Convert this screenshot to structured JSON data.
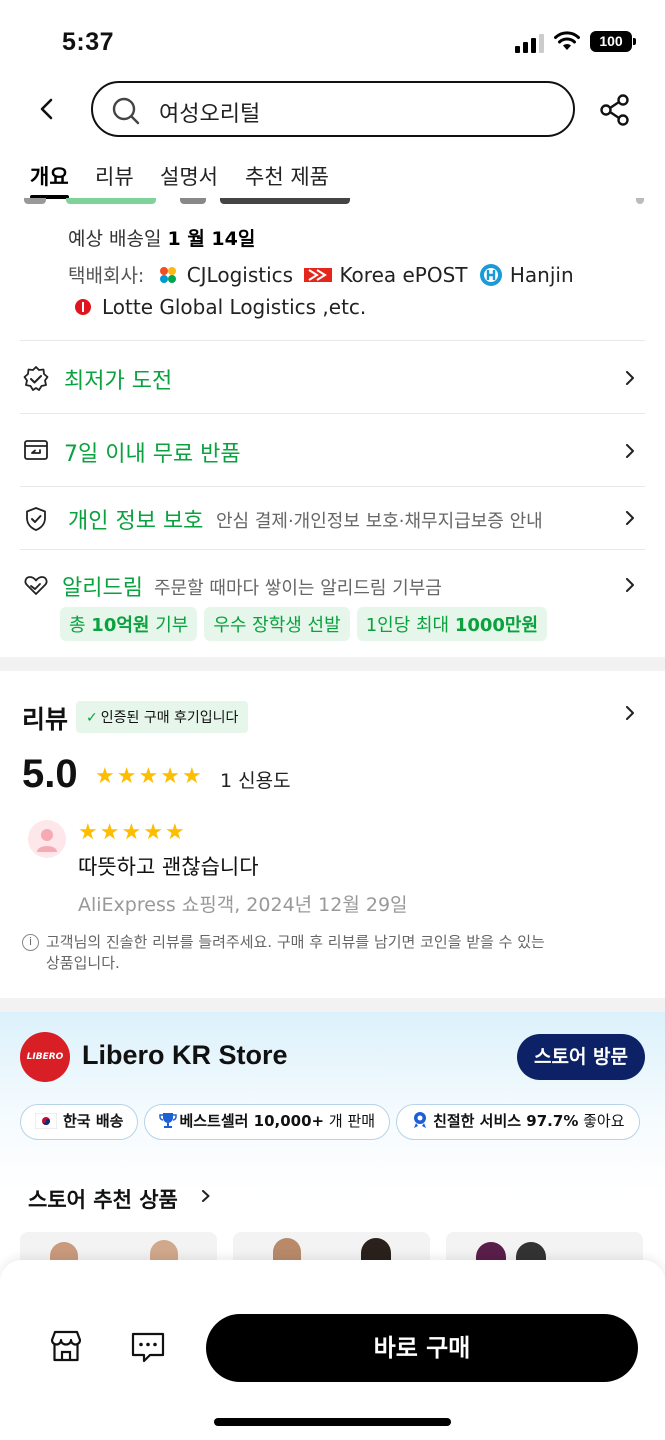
{
  "status": {
    "time": "5:37",
    "battery": "100"
  },
  "search": {
    "query": "여성오리털"
  },
  "tabs": [
    {
      "label": "개요",
      "active": true
    },
    {
      "label": "리뷰"
    },
    {
      "label": "설명서"
    },
    {
      "label": "추천 제품"
    }
  ],
  "shipping": {
    "date_prefix": "예상 배송일 ",
    "date": "1 월 14일",
    "carriers_label": "택배회사:",
    "carriers": [
      "CJLogistics",
      "Korea ePOST",
      "Hanjin",
      "Lotte Global Logistics ,etc."
    ]
  },
  "rows": {
    "lowest": "최저가 도전",
    "returns": "7일 이내 무료 반품",
    "privacy_title": "개인 정보 보호",
    "privacy_sub": "안심 결제·개인정보 보호·채무지급보증 안내",
    "alidream_title": "알리드림",
    "alidream_sub": "주문할 때마다 쌓이는 알리드림 기부금",
    "pills": {
      "p1_pre": "총 ",
      "p1_bold": "10억원",
      "p1_post": " 기부",
      "p2": "우수 장학생 선발",
      "p3_pre": "1인당 최대 ",
      "p3_bold": "1000만원"
    }
  },
  "review": {
    "title": "리뷰",
    "verified": "인증된 구매 후기입니다",
    "score": "5.0",
    "count": "1 신용도",
    "rating": 5,
    "text": "따뜻하고 괜찮습니다",
    "meta": "AliExpress 쇼핑객, 2024년 12월 29일",
    "notice": "고객님의 진솔한 리뷰를 들려주세요. 구매 후 리뷰를 남기면 코인을 받을 수 있는 상품입니다."
  },
  "store": {
    "logo_text": "LIBERO",
    "name": "Libero KR Store",
    "visit": "스토어 방문",
    "chip1": "한국 배송",
    "chip2_bold": "베스트셀러 10,000+",
    "chip2_rest": " 개 판매",
    "chip3_bold": "친절한 서비스 97.7%",
    "chip3_rest": " 좋아요",
    "rec_title": "스토어 추천 상품"
  },
  "bottom": {
    "buy": "바로 구매"
  },
  "colors": {
    "accent_green": "#0aa23e",
    "star": "#fdbd00",
    "store_button": "#0d2266"
  }
}
